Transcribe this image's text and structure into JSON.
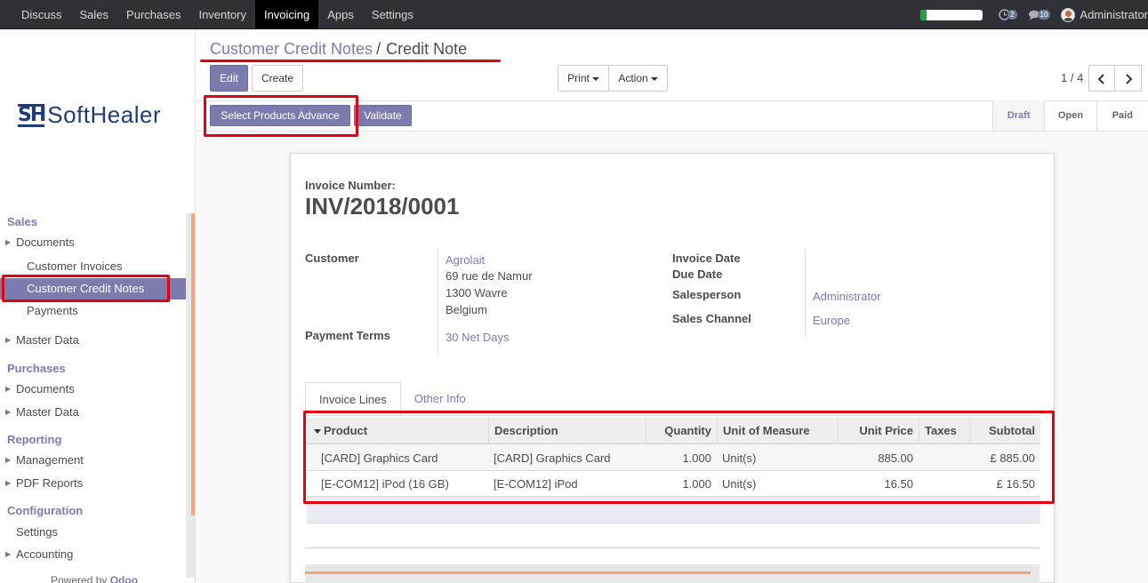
{
  "topnav": {
    "items": [
      "Discuss",
      "Sales",
      "Purchases",
      "Inventory",
      "Invoicing",
      "Apps",
      "Settings"
    ],
    "active_index": 4,
    "progress_fraction": 0.1,
    "activity_count": "2",
    "messages_count": "10",
    "user": "Administrator"
  },
  "logo": {
    "mark": "SH",
    "name": "SoftHealer"
  },
  "sidebar": {
    "sales": "Sales",
    "documents": "Documents",
    "customer_invoices": "Customer Invoices",
    "customer_credit_notes": "Customer Credit Notes",
    "payments": "Payments",
    "master_data": "Master Data",
    "purchases": "Purchases",
    "p_documents": "Documents",
    "p_master_data": "Master Data",
    "reporting": "Reporting",
    "management": "Management",
    "pdf_reports": "PDF Reports",
    "configuration": "Configuration",
    "settings": "Settings",
    "accounting": "Accounting",
    "powered_prefix": "Powered by",
    "powered_brand": "Odoo"
  },
  "breadcrumb": {
    "parent": "Customer Credit Notes",
    "separator": "/",
    "current": "Credit Note"
  },
  "buttons": {
    "edit": "Edit",
    "create": "Create",
    "print": "Print",
    "action": "Action",
    "select_products": "Select Products Advance",
    "validate": "Validate"
  },
  "pager": {
    "text": "1 / 4"
  },
  "status": {
    "steps": [
      "Draft",
      "Open",
      "Paid"
    ],
    "active": "Draft"
  },
  "invoice": {
    "number_label": "Invoice Number:",
    "number": "INV/2018/0001",
    "customer_label": "Customer",
    "customer_name": "Agrolait",
    "address1": "69 rue de Namur",
    "address2": "1300 Wavre",
    "address3": "Belgium",
    "payment_terms_label": "Payment Terms",
    "payment_terms": "30 Net Days",
    "invoice_date_label": "Invoice Date",
    "due_date_label": "Due Date",
    "salesperson_label": "Salesperson",
    "salesperson": "Administrator",
    "sales_channel_label": "Sales Channel",
    "sales_channel": "Europe"
  },
  "tabs": {
    "lines": "Invoice Lines",
    "other": "Other Info"
  },
  "lines": {
    "columns": {
      "product": "Product",
      "description": "Description",
      "quantity": "Quantity",
      "uom": "Unit of Measure",
      "unit_price": "Unit Price",
      "taxes": "Taxes",
      "subtotal": "Subtotal"
    },
    "rows": [
      {
        "product": "[CARD] Graphics Card",
        "description": "[CARD] Graphics Card",
        "quantity": "1.000",
        "uom": "Unit(s)",
        "unit_price": "885.00",
        "taxes": "",
        "subtotal": "£ 885.00"
      },
      {
        "product": "[E-COM12] iPod (16 GB)",
        "description": "[E-COM12] iPod",
        "quantity": "1.000",
        "uom": "Unit(s)",
        "unit_price": "16.50",
        "taxes": "",
        "subtotal": "£ 16.50"
      }
    ]
  },
  "colors": {
    "accent": "#7c7bad",
    "highlight": "#e3000f",
    "topbar": "#2f3136"
  }
}
